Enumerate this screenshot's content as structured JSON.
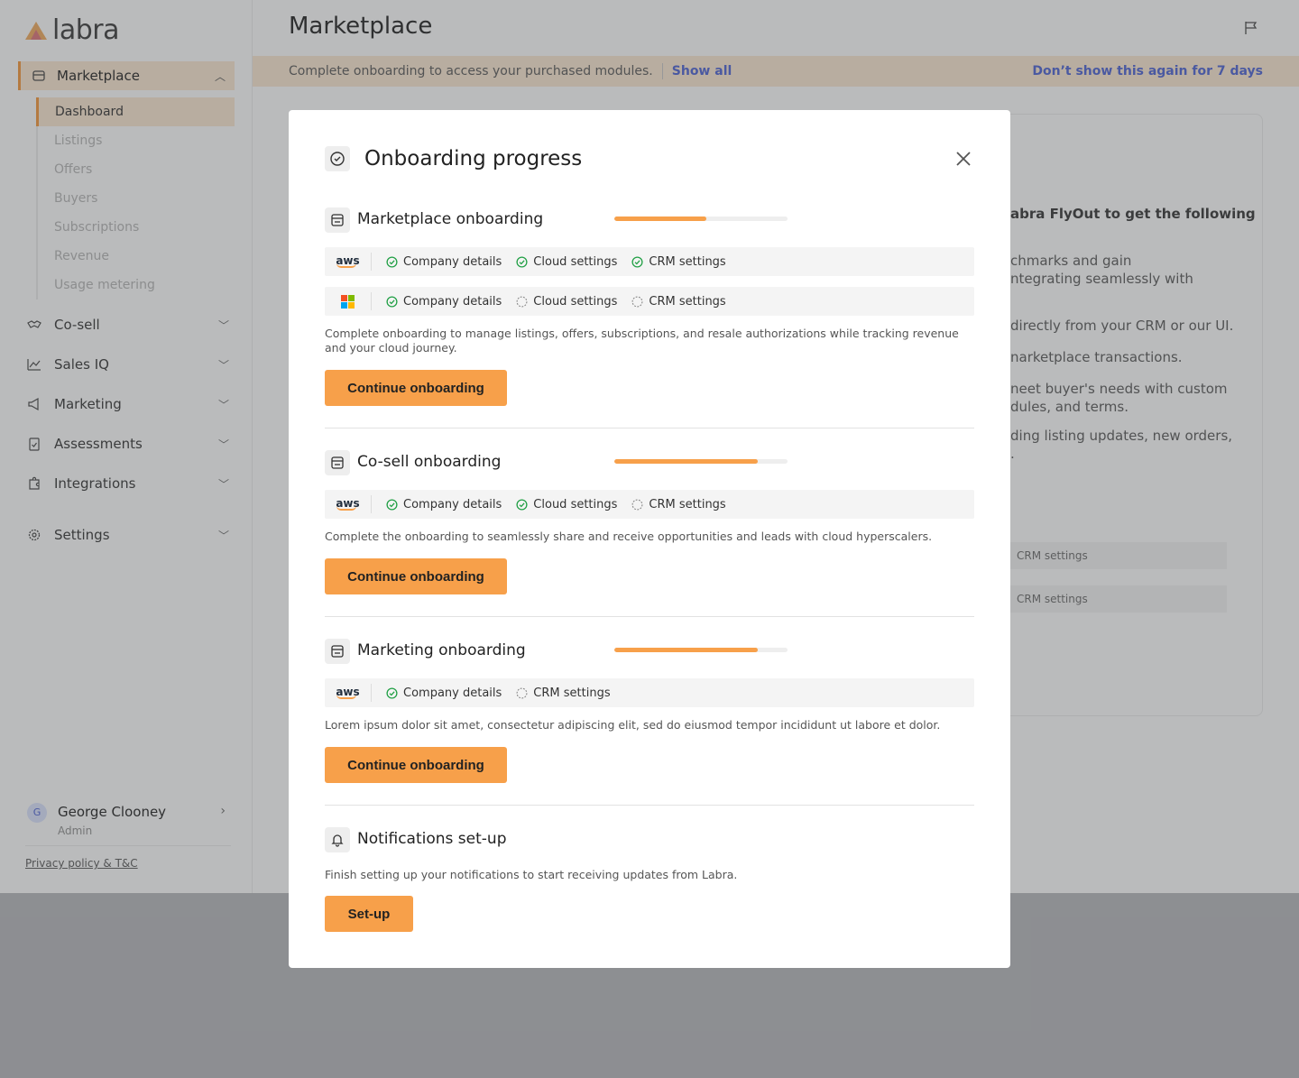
{
  "app": {
    "logo_text": "labra",
    "page_title": "Marketplace"
  },
  "sidebar": {
    "marketplace": {
      "label": "Marketplace",
      "items": [
        "Dashboard",
        "Listings",
        "Offers",
        "Buyers",
        "Subscriptions",
        "Revenue",
        "Usage metering"
      ]
    },
    "items": [
      {
        "label": "Co-sell"
      },
      {
        "label": "Sales IQ"
      },
      {
        "label": "Marketing"
      },
      {
        "label": "Assessments"
      },
      {
        "label": "Integrations"
      },
      {
        "label": "Settings"
      }
    ],
    "user": {
      "initial": "G",
      "name": "George Clooney",
      "role": "Admin"
    },
    "privacy": "Privacy policy & T&C"
  },
  "banner": {
    "text": "Complete onboarding to access your purchased modules.",
    "show_all": "Show all",
    "dismiss": "Don’t show this again for 7 days"
  },
  "background_card": {
    "lines": [
      "abra FlyOut to get the following",
      "chmarks and gain",
      "ntegrating seamlessly with",
      "directly from your CRM or our UI.",
      "narketplace transactions.",
      "neet buyer's needs with custom",
      "dules, and terms.",
      "ding listing updates, new orders,",
      "."
    ],
    "crm_label": "CRM settings"
  },
  "modal": {
    "title": "Onboarding progress",
    "sections": [
      {
        "title": "Marketplace onboarding",
        "progress": 0.53,
        "rows": [
          {
            "cloud": "aws",
            "steps": [
              {
                "label": "Company details",
                "done": true
              },
              {
                "label": "Cloud settings",
                "done": true
              },
              {
                "label": "CRM settings",
                "done": true
              }
            ]
          },
          {
            "cloud": "azure",
            "steps": [
              {
                "label": "Company details",
                "done": true
              },
              {
                "label": "Cloud settings",
                "done": false
              },
              {
                "label": "CRM settings",
                "done": false
              }
            ]
          }
        ],
        "description": "Complete onboarding to manage listings, offers, subscriptions, and resale authorizations while tracking revenue and your cloud journey.",
        "button": "Continue onboarding"
      },
      {
        "title": "Co-sell onboarding",
        "progress": 0.83,
        "rows": [
          {
            "cloud": "aws",
            "steps": [
              {
                "label": "Company details",
                "done": true
              },
              {
                "label": "Cloud settings",
                "done": true
              },
              {
                "label": "CRM settings",
                "done": false
              }
            ]
          }
        ],
        "description": "Complete the onboarding to seamlessly share and receive opportunities and leads with cloud hyperscalers.",
        "button": "Continue onboarding"
      },
      {
        "title": "Marketing onboarding",
        "progress": 0.83,
        "rows": [
          {
            "cloud": "aws",
            "steps": [
              {
                "label": "Company details",
                "done": true
              },
              {
                "label": "CRM settings",
                "done": false
              }
            ]
          }
        ],
        "description": "Lorem ipsum dolor sit amet, consectetur adipiscing elit, sed do eiusmod tempor incididunt ut labore et dolor.",
        "button": "Continue onboarding"
      }
    ],
    "notifications": {
      "title": "Notifications set-up",
      "description": "Finish setting up your notifications to start receiving updates from Labra.",
      "button": "Set-up"
    }
  },
  "colors": {
    "accent": "#f7a04a",
    "accent_light": "#fdebd6",
    "link": "#5b6fd8",
    "success": "#22a046",
    "overlay": "#bdbec1"
  },
  "icons": {
    "aws_text": "aws"
  }
}
